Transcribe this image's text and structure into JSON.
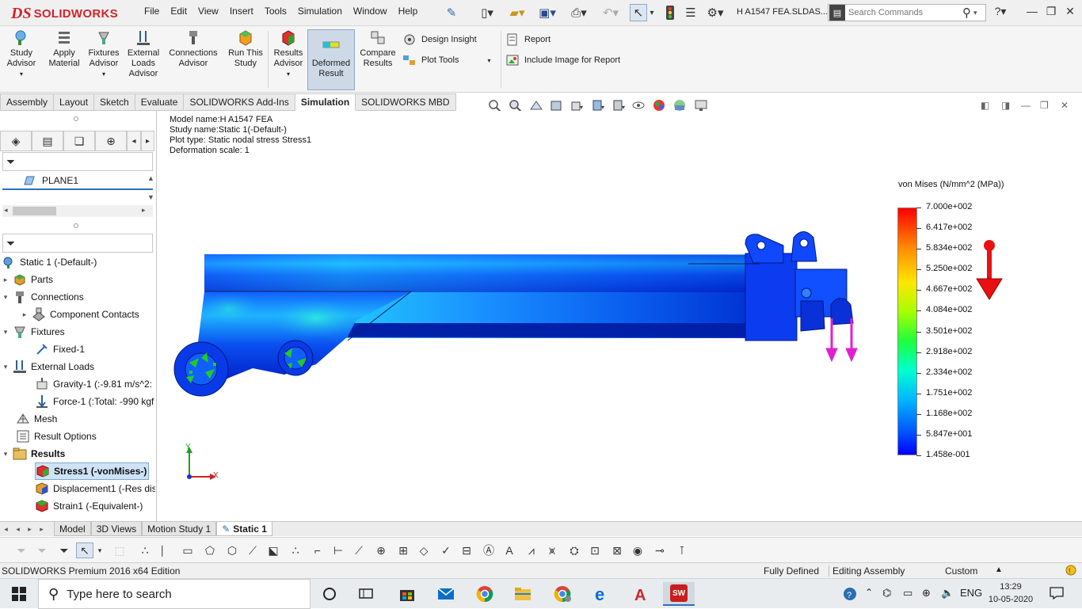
{
  "app": {
    "logo_prefix": "DS",
    "logo_text": "SOLIDWORKS",
    "document_title": "H A1547 FEA.SLDAS..."
  },
  "menu": [
    "File",
    "Edit",
    "View",
    "Insert",
    "Tools",
    "Simulation",
    "Window",
    "Help"
  ],
  "search": {
    "placeholder": "Search Commands"
  },
  "ribbon": {
    "study_advisor": "Study Advisor",
    "apply_material": "Apply Material",
    "fixtures_advisor": "Fixtures Advisor",
    "external_loads_advisor": "External Loads Advisor",
    "connections_advisor": "Connections Advisor",
    "run_this_study": "Run This Study",
    "results_advisor": "Results Advisor",
    "deformed_result": "Deformed Result",
    "compare_results": "Compare Results",
    "design_insight": "Design Insight",
    "plot_tools": "Plot Tools",
    "report": "Report",
    "include_image": "Include Image for Report"
  },
  "command_tabs": [
    {
      "label": "Assembly",
      "active": false
    },
    {
      "label": "Layout",
      "active": false
    },
    {
      "label": "Sketch",
      "active": false
    },
    {
      "label": "Evaluate",
      "active": false
    },
    {
      "label": "SOLIDWORKS Add-Ins",
      "active": false
    },
    {
      "label": "Simulation",
      "active": true
    },
    {
      "label": "SOLIDWORKS MBD",
      "active": false
    }
  ],
  "left_panel": {
    "plane_item": "PLANE1",
    "tree": {
      "study": "Static 1 (-Default-)",
      "parts": "Parts",
      "connections": "Connections",
      "component_contacts": "Component Contacts",
      "fixtures": "Fixtures",
      "fixed": "Fixed-1",
      "external_loads": "External Loads",
      "gravity": "Gravity-1 (:-9.81 m/s^2:",
      "force": "Force-1 (:Total: -990 kgf",
      "mesh": "Mesh",
      "result_options": "Result Options",
      "results": "Results",
      "stress": "Stress1 (-vonMises-)",
      "displacement": "Displacement1 (-Res dis",
      "strain": "Strain1 (-Equivalent-)"
    }
  },
  "plot_info": {
    "model_name": "Model name:H A1547 FEA",
    "study_name": "Study name:Static 1(-Default-)",
    "plot_type": "Plot type: Static nodal stress Stress1",
    "deformation_scale": "Deformation scale: 1"
  },
  "legend": {
    "title": "von Mises (N/mm^2 (MPa))",
    "values": [
      "7.000e+002",
      "6.417e+002",
      "5.834e+002",
      "5.250e+002",
      "4.667e+002",
      "4.084e+002",
      "3.501e+002",
      "2.918e+002",
      "2.334e+002",
      "1.751e+002",
      "1.168e+002",
      "5.847e+001",
      "1.458e-001"
    ]
  },
  "triad": {
    "x_label": "X",
    "y_label": "Y"
  },
  "bottom_tabs": [
    {
      "label": "Model",
      "active": false
    },
    {
      "label": "3D Views",
      "active": false
    },
    {
      "label": "Motion Study 1",
      "active": false
    },
    {
      "label": "Static 1",
      "active": true
    }
  ],
  "status_bar": {
    "edition": "SOLIDWORKS Premium 2016 x64 Edition",
    "state": "Fully Defined",
    "mode": "Editing Assembly",
    "units": "Custom"
  },
  "taskbar": {
    "search_placeholder": "Type here to search",
    "language": "ENG",
    "time": "13:29",
    "date": "10-05-2020"
  },
  "colors": {
    "brand_red": "#d2232a",
    "stress_low": "#0000ff",
    "stress_high": "#ff0000",
    "force_arrow": "#e020d0",
    "fixture_green": "#22cc22"
  }
}
